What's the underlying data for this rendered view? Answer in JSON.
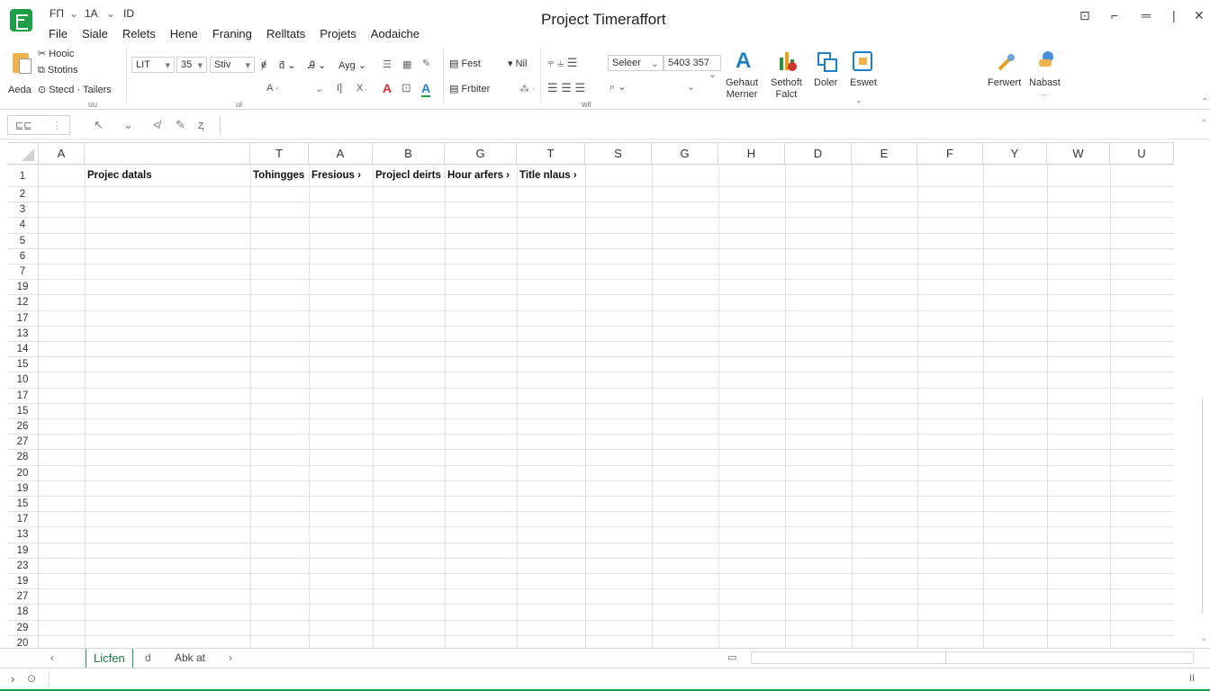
{
  "title_bar": {
    "qat_items": [
      "FΠ",
      "1A",
      "ID"
    ],
    "document_title": "Project Timeraffort",
    "menu": [
      "File",
      "Siale",
      "Relets",
      "Hene",
      "Franing",
      "Relltats",
      "Projets",
      "Aodaiche"
    ]
  },
  "ribbon": {
    "clipboard": {
      "paste_label": "Aeda",
      "row1": "Hooic",
      "row2": "Stotins",
      "row3": "Stecd · Tailers",
      "group_label": "uu"
    },
    "font": {
      "font_name": "LIT",
      "font_size": "35",
      "style_name": "Stiv",
      "format_label": "Ayg",
      "group_label": "ul"
    },
    "text": {
      "text_label": "Fest",
      "nil_label": "Nil",
      "frbiter_label": "Frbiter"
    },
    "number": {
      "format_value": "Seleer",
      "number_value": "5403 357",
      "group_label": "wil"
    },
    "big_buttons": [
      {
        "label": "Gehaut\nMerner"
      },
      {
        "label": "Sethoft\nFalct"
      },
      {
        "label": "Doler"
      },
      {
        "label": "Eswet"
      }
    ],
    "right_buttons": [
      {
        "label": "Ferwert"
      },
      {
        "label": "Nabast"
      }
    ]
  },
  "formula_bar": {
    "name_box": "⊑⊑",
    "input_value": ""
  },
  "columns": [
    "A",
    "",
    "T",
    "A",
    "B",
    "G",
    "T",
    "S",
    "G",
    "H",
    "D",
    "E",
    "F",
    "Y",
    "W",
    "U"
  ],
  "row_numbers": [
    "1",
    "2",
    "3",
    "4",
    "5",
    "6",
    "7",
    "19",
    "12",
    "17",
    "13",
    "14",
    "15",
    "10",
    "17",
    "15",
    "26",
    "27",
    "28",
    "20",
    "19",
    "15",
    "17",
    "13",
    "19",
    "23",
    "19",
    "27",
    "18",
    "29",
    "20"
  ],
  "header_cells": [
    {
      "col": 1,
      "text": "Projec datals"
    },
    {
      "col": 2,
      "text": "Tohingges"
    },
    {
      "col": 3,
      "text": "Fresious ›"
    },
    {
      "col": 4,
      "text": "Projecl deirts ›"
    },
    {
      "col": 5,
      "text": "Hour arfers ›"
    },
    {
      "col": 6,
      "text": "Title nlaus ›"
    }
  ],
  "sheet_tabs": {
    "active": "Licfen",
    "active_suffix": "d",
    "other": "Abk at"
  },
  "status_bar": {
    "left": "›",
    "right": "II"
  },
  "colors": {
    "accent": "#1f9e4a",
    "grid": "#e2e2e2"
  }
}
